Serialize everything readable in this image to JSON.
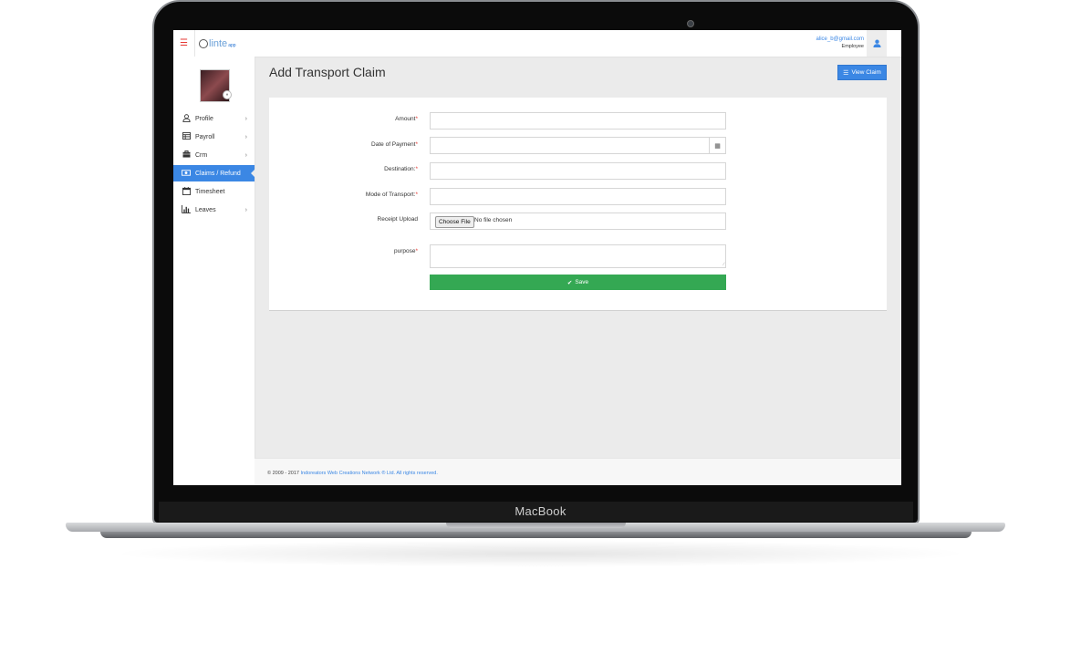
{
  "device": {
    "brand_label": "MacBook"
  },
  "topbar": {
    "menu_icon": "hamburger-icon",
    "logo_text": "linte",
    "logo_sub": "app",
    "user_email": "alice_b@gmail.com",
    "user_role": "Employee",
    "user_icon": "user-icon"
  },
  "sidebar": {
    "items": [
      {
        "label": "Profile",
        "icon": "user-outline-icon",
        "has_chevron": true,
        "active": false
      },
      {
        "label": "Payroll",
        "icon": "table-icon",
        "has_chevron": true,
        "active": false
      },
      {
        "label": "Crm",
        "icon": "briefcase-icon",
        "has_chevron": true,
        "active": false
      },
      {
        "label": "Claims / Refund",
        "icon": "money-icon",
        "has_chevron": false,
        "active": true
      },
      {
        "label": "Timesheet",
        "icon": "calendar-icon",
        "has_chevron": false,
        "active": false
      },
      {
        "label": "Leaves",
        "icon": "bar-chart-icon",
        "has_chevron": true,
        "active": false
      }
    ]
  },
  "main": {
    "title": "Add Transport Claim",
    "view_claim_label": "View Claim"
  },
  "form": {
    "amount_label": "Amount",
    "date_label": "Date of Payment",
    "destination_label": "Destination:",
    "mode_label": "Mode of Transport:",
    "receipt_label": "Receipt Upload",
    "choose_file_label": "Choose File",
    "no_file_text": "No file chosen",
    "purpose_label": "purpose",
    "required_mark": "*",
    "save_label": "Save"
  },
  "footer": {
    "prefix": "© 2009 - 2017",
    "link_text": "Indoreators Web Creations Network ® Ltd. All rights reserved."
  },
  "colors": {
    "accent": "#3b87e4",
    "save": "#34a853",
    "required": "#e53935"
  }
}
